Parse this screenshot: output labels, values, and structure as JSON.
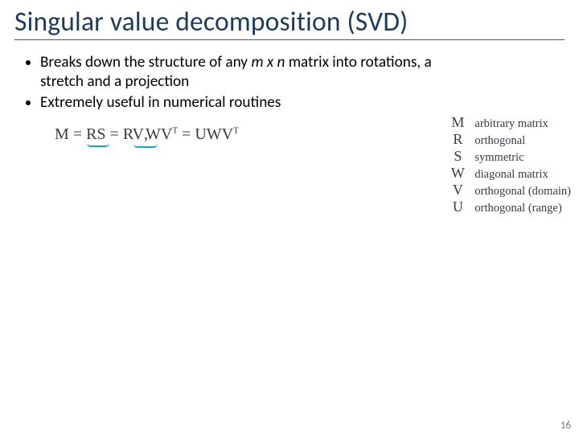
{
  "title": "Singular value decomposition (SVD)",
  "bullets": [
    {
      "pre": "Breaks down the structure of any ",
      "mn": "m x n",
      "post": "  matrix into rotations, a stretch and a projection"
    },
    {
      "pre": "Extremely useful in numerical routines",
      "mn": "",
      "post": ""
    }
  ],
  "equation": {
    "lhs": "M =",
    "rs": "RS",
    "eq2": "=",
    "rv": "RV",
    "wv": "WV",
    "t1": "T",
    "eq3": "=",
    "uwv": "UWV",
    "t2": "T"
  },
  "legend": [
    {
      "sym": "M",
      "desc": "arbitrary matrix"
    },
    {
      "sym": "R",
      "desc": "orthogonal"
    },
    {
      "sym": "S",
      "desc": "symmetric"
    },
    {
      "sym": "W",
      "desc": "diagonal matrix"
    },
    {
      "sym": "V",
      "desc": "orthogonal (domain)"
    },
    {
      "sym": "U",
      "desc": "orthogonal (range)"
    }
  ],
  "page_number": "16"
}
